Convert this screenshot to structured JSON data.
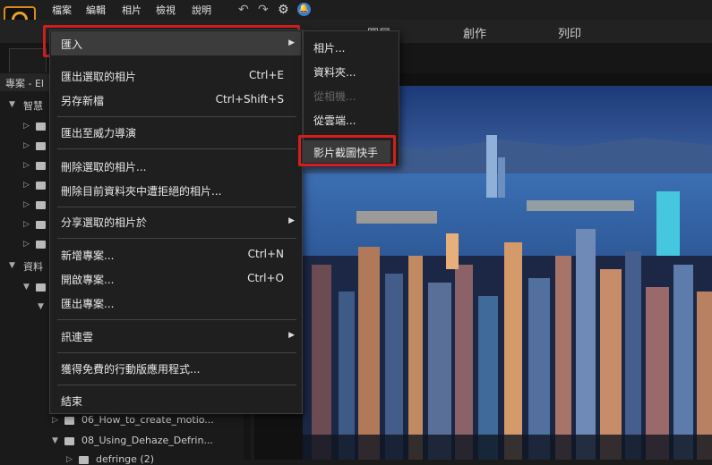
{
  "menubar": {
    "items": [
      "檔案",
      "編輯",
      "相片",
      "檢視",
      "說明"
    ],
    "icons": [
      "undo-icon",
      "redo-icon",
      "gear-icon",
      "notification-icon"
    ]
  },
  "modules": [
    "圖層",
    "創作",
    "列印"
  ],
  "left_panel": {
    "header": "專案 - El",
    "section_smart": "智慧",
    "section_data": "資料",
    "folders": [
      "06_How_to_create_motio...",
      "08_Using_Dehaze_Defrin...",
      "defringe (2)"
    ]
  },
  "file_menu": {
    "items": [
      {
        "label": "匯入",
        "shortcut": "",
        "submenu": true
      },
      {
        "label": "匯出選取的相片",
        "shortcut": "Ctrl+E",
        "submenu": false
      },
      {
        "label": "另存新檔",
        "shortcut": "Ctrl+Shift+S",
        "submenu": false
      },
      {
        "label": "匯出至威力導演",
        "shortcut": "",
        "submenu": false
      },
      {
        "label": "刪除選取的相片...",
        "shortcut": "",
        "submenu": false
      },
      {
        "label": "刪除目前資料夾中遭拒絕的相片...",
        "shortcut": "",
        "submenu": false
      },
      {
        "label": "分享選取的相片於",
        "shortcut": "",
        "submenu": true
      },
      {
        "label": "新增專案...",
        "shortcut": "Ctrl+N",
        "submenu": false
      },
      {
        "label": "開啟專案...",
        "shortcut": "Ctrl+O",
        "submenu": false
      },
      {
        "label": "匯出專案...",
        "shortcut": "",
        "submenu": false
      },
      {
        "label": "訊連雲",
        "shortcut": "",
        "submenu": true
      },
      {
        "label": "獲得免費的行動版應用程式...",
        "shortcut": "",
        "submenu": false
      },
      {
        "label": "結束",
        "shortcut": "",
        "submenu": false
      }
    ]
  },
  "import_submenu": {
    "items": [
      {
        "label": "相片...",
        "enabled": true
      },
      {
        "label": "資料夾...",
        "enabled": true
      },
      {
        "label": "從相機...",
        "enabled": false
      },
      {
        "label": "從雲端...",
        "enabled": true
      },
      {
        "label": "影片截圖快手",
        "enabled": true
      }
    ]
  },
  "colors": {
    "highlight_border": "#d41e1e",
    "accent": "#e6a22a"
  }
}
